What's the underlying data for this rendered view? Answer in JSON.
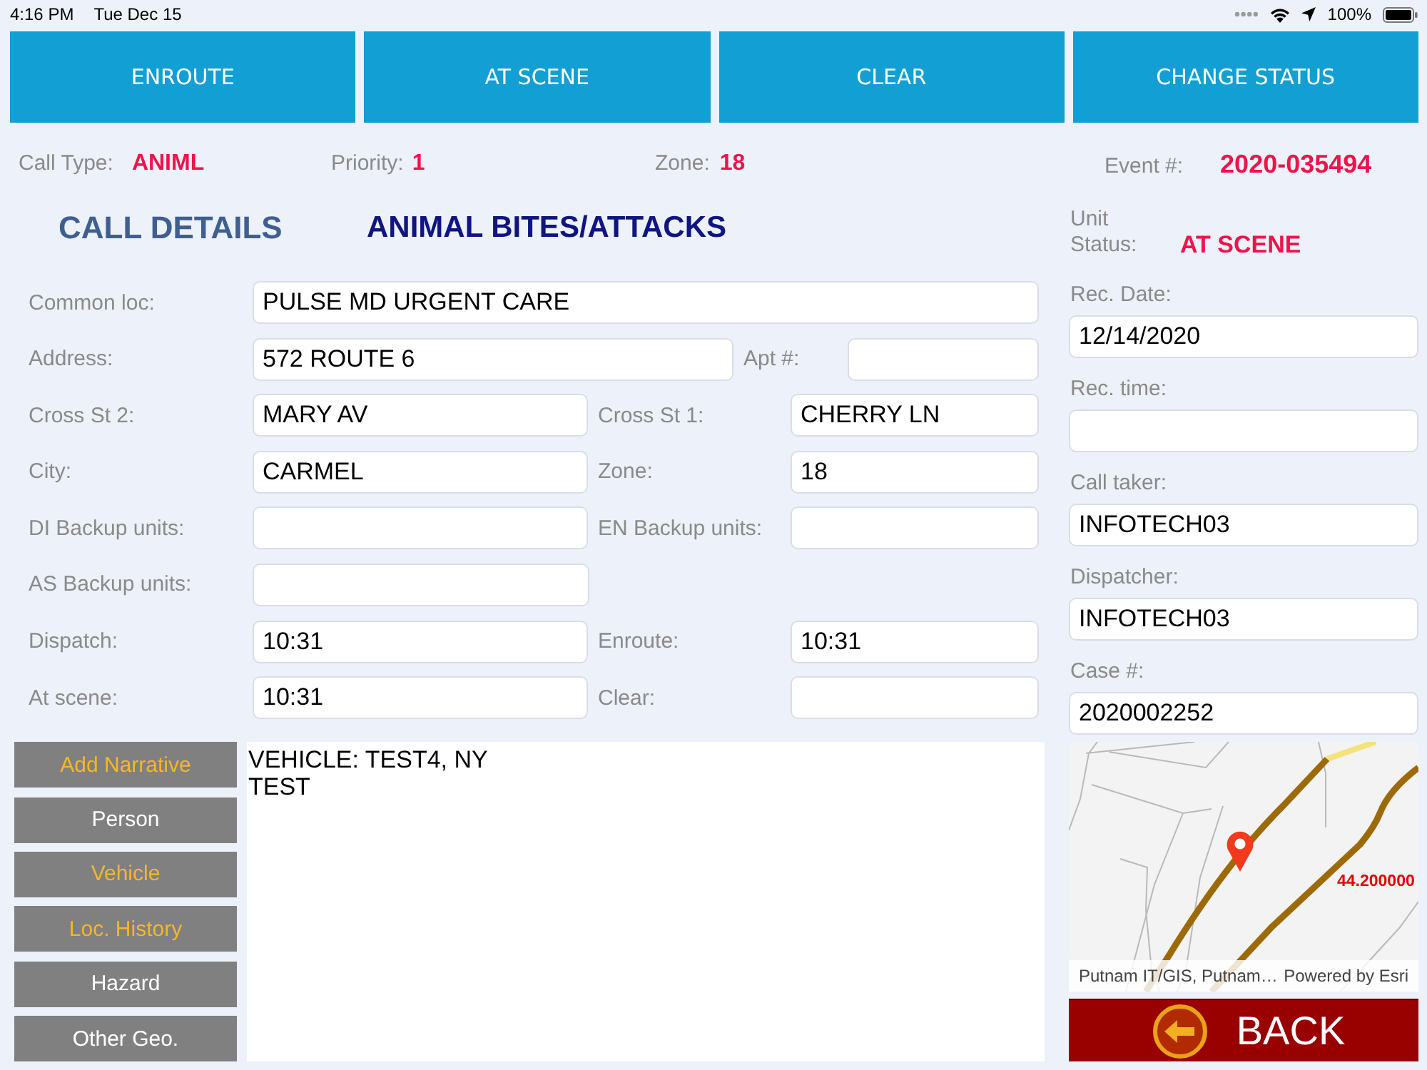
{
  "status_bar": {
    "time": "4:16 PM",
    "date": "Tue Dec 15",
    "battery": "100%"
  },
  "action_buttons": [
    "ENROUTE",
    "AT SCENE",
    "CLEAR",
    "CHANGE STATUS"
  ],
  "summary": [
    {
      "label": "Call Type:",
      "value": "ANIML"
    },
    {
      "label": "Priority:",
      "value": "1"
    },
    {
      "label": "Zone:",
      "value": "18"
    },
    {
      "label": "Event #:",
      "value": "2020-035494"
    }
  ],
  "section_title": "CALL DETAILS",
  "call_title": "ANIMAL BITES/ATTACKS",
  "unit_status": {
    "label": "Unit Status:",
    "value": "AT SCENE"
  },
  "form_rows": [
    {
      "kind": "full",
      "fields": [
        {
          "label": "Common loc:",
          "value": "PULSE MD URGENT CARE"
        }
      ]
    },
    {
      "kind": "address",
      "fields": [
        {
          "label": "Address:",
          "value": "572 ROUTE 6"
        },
        {
          "label": "Apt #:"
        }
      ]
    },
    {
      "kind": "pair",
      "fields": [
        {
          "label": "Cross St 2:",
          "value": "MARY AV"
        },
        {
          "label": "Cross St 1:",
          "value": "CHERRY LN"
        }
      ]
    },
    {
      "kind": "pair",
      "fields": [
        {
          "label": "City:",
          "value": "CARMEL"
        },
        {
          "label": "Zone:",
          "value": "18"
        }
      ]
    },
    {
      "kind": "pair",
      "fields": [
        {
          "label": "DI Backup units:"
        },
        {
          "label": "EN Backup units:"
        }
      ]
    },
    {
      "kind": "half",
      "fields": [
        {
          "label": "AS Backup units:"
        }
      ]
    },
    {
      "kind": "pair",
      "fields": [
        {
          "label": "Dispatch:",
          "value": "10:31"
        },
        {
          "label": "Enroute:",
          "value": "10:31"
        }
      ]
    },
    {
      "kind": "pair",
      "fields": [
        {
          "label": "At scene:",
          "value": "10:31"
        },
        {
          "label": "Clear:"
        }
      ]
    }
  ],
  "record_fields": [
    {
      "label": "Rec. Date:",
      "value": "12/14/2020"
    },
    {
      "label": "Rec. time:"
    },
    {
      "label": "Call taker:",
      "value": "INFOTECH03"
    },
    {
      "label": "Dispatcher:",
      "value": "INFOTECH03"
    },
    {
      "label": "Case #:",
      "value": "2020002252"
    }
  ],
  "side_buttons": [
    {
      "label": "Add Narrative",
      "highlighted": true
    },
    {
      "label": "Person",
      "highlighted": false
    },
    {
      "label": "Vehicle",
      "highlighted": true
    },
    {
      "label": "Loc. History",
      "highlighted": true
    },
    {
      "label": "Hazard",
      "highlighted": false
    },
    {
      "label": "Other Geo.",
      "highlighted": false
    }
  ],
  "narrative": "VEHICLE: TEST4, NY\nTEST",
  "map": {
    "label": "44.200000",
    "attribution": "Putnam IT/GIS, Putnam…",
    "credit": "Powered by Esri"
  },
  "back_button": "BACK"
}
